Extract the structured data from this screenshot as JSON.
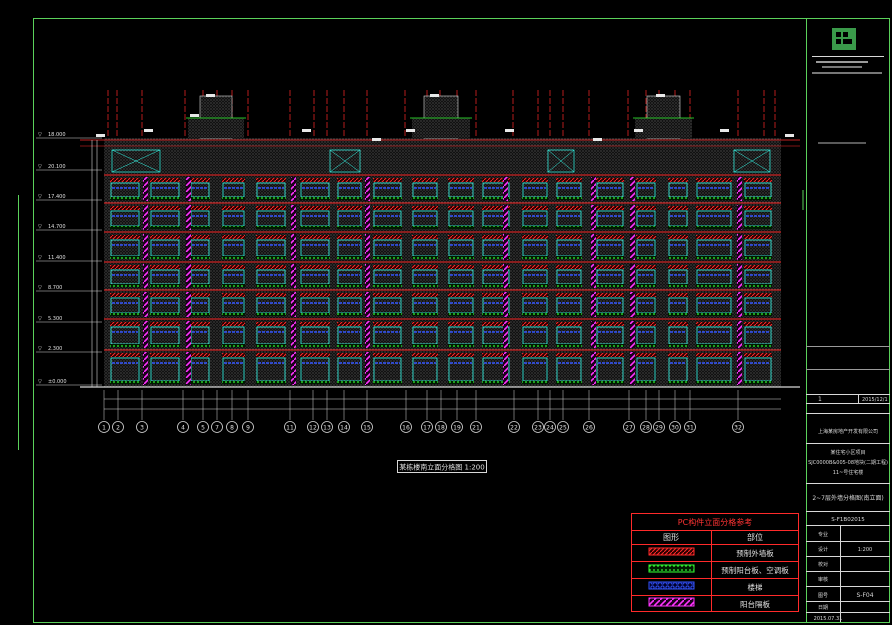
{
  "drawing": {
    "caption": "某栋楼南立面分格图 1:200",
    "level_labels": [
      "18.000",
      "20.100",
      "17.400",
      "14.700",
      "11.400",
      "8.700",
      "5.300",
      "2.300",
      "±0.000"
    ],
    "axis_labels": [
      "1",
      "2",
      "3",
      "4",
      "5",
      "7",
      "8",
      "9",
      "11",
      "12",
      "13",
      "14",
      "15",
      "16",
      "17",
      "18",
      "19",
      "21",
      "22",
      "23",
      "24",
      "25",
      "26",
      "27",
      "28",
      "29",
      "30",
      "31",
      "32"
    ]
  },
  "legend": {
    "title": "PC构件立面分格参考",
    "col_figure": "图形",
    "col_part": "部位",
    "rows": [
      {
        "part": "预制外墙板",
        "color": "#ff2222",
        "pattern": "hatch"
      },
      {
        "part": "预制阳台板、空调板",
        "color": "#22ff22",
        "pattern": "dots"
      },
      {
        "part": "楼梯",
        "color": "#2244ff",
        "pattern": "circles"
      },
      {
        "part": "阳台隔板",
        "color": "#ff22ff",
        "pattern": "diag"
      }
    ]
  },
  "title_block": {
    "project_lines": [
      "上海某房地产开发有限公司",
      "某住宅小区项目",
      "SJC0000B&005-08地块(二期工程)",
      "11~号住宅楼"
    ],
    "sheet_title": "2~7层外墙分格图(南立面)",
    "drawing_no": "S-F1B02015",
    "scale": "1:200",
    "revision": "1",
    "date_top": "2015/12/1",
    "sheet_no": "S-F04",
    "date": "2015.07.31",
    "row_labels": [
      "专业",
      "设计",
      "校对",
      "审核",
      "图号",
      "日期"
    ]
  },
  "colors": {
    "frame": "#5ad15a",
    "grid_red": "#ff2a2a",
    "tb_white": "#d8d8d8",
    "green_logo": "#3a9a4a"
  }
}
